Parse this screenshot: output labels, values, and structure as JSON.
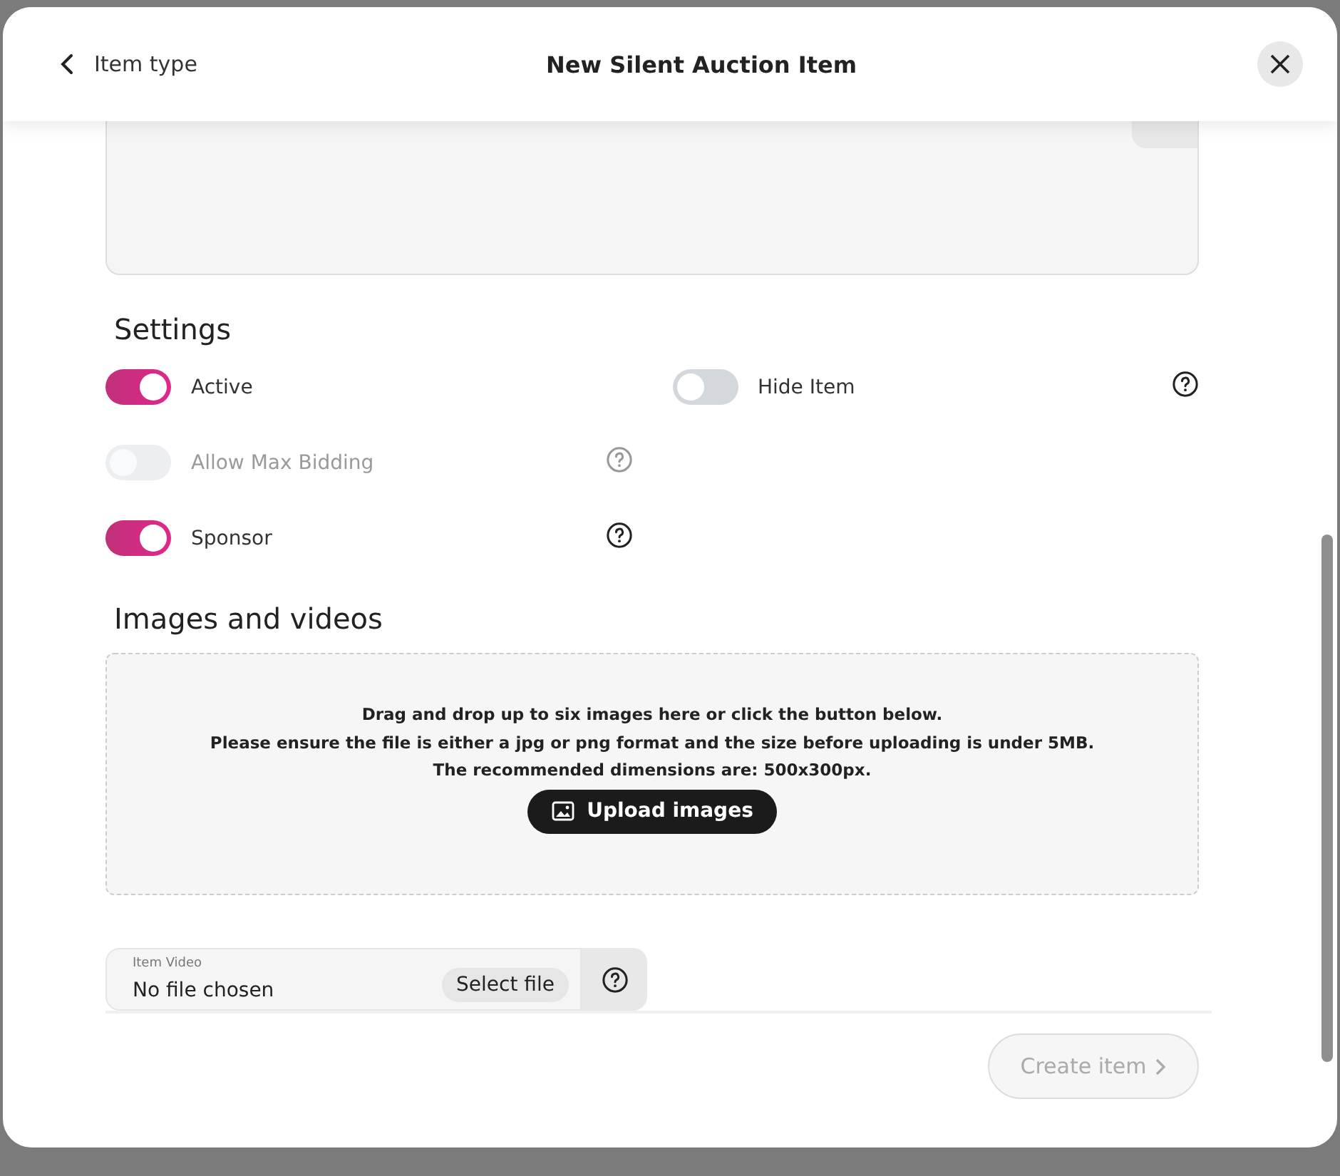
{
  "header": {
    "back_label": "Item type",
    "title": "New Silent Auction Item"
  },
  "settings": {
    "heading": "Settings",
    "toggles": [
      {
        "label": "Active",
        "on": true,
        "disabled": false,
        "help": false
      },
      {
        "label": "Hide Item",
        "on": false,
        "disabled": false,
        "help": true
      },
      {
        "label": "Allow Max Bidding",
        "on": false,
        "disabled": true,
        "help": true
      },
      {
        "label": "Sponsor",
        "on": true,
        "disabled": false,
        "help": true
      }
    ]
  },
  "media": {
    "heading": "Images and videos",
    "drop_lines": [
      "Drag and drop up to six images here or click the button below.",
      "Please ensure the file is either a jpg or png format and the size before uploading is under 5MB.",
      "The recommended dimensions are: 500x300px."
    ],
    "upload_button": "Upload images"
  },
  "video": {
    "label": "Item Video",
    "value": "No file chosen",
    "button": "Select file"
  },
  "footer": {
    "create_button": "Create item",
    "disabled": true
  }
}
